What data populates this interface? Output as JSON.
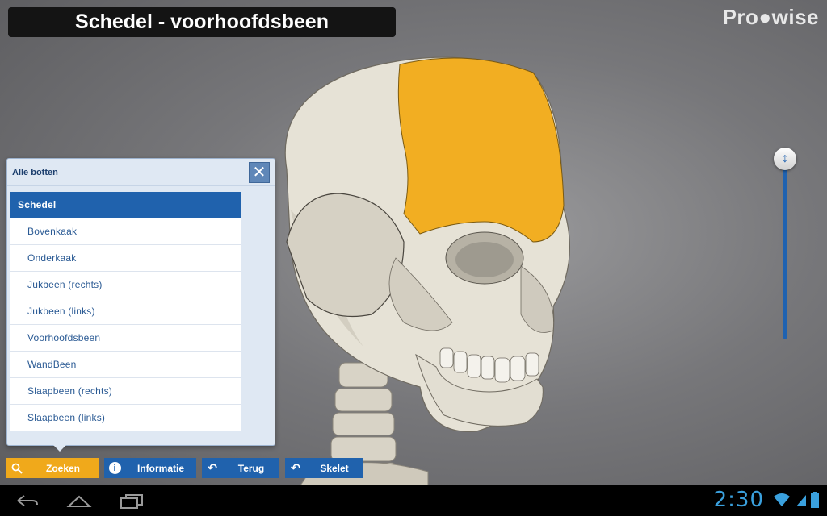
{
  "header": {
    "title": "Schedel - voorhoofdsbeen"
  },
  "brand": {
    "logo_text": "Pro●wise"
  },
  "panel": {
    "title": "Alle botten",
    "close_icon": "close-icon",
    "items": [
      {
        "label": "Schedel",
        "selected": true
      },
      {
        "label": "Bovenkaak"
      },
      {
        "label": "Onderkaak"
      },
      {
        "label": "Jukbeen (rechts)"
      },
      {
        "label": "Jukbeen (links)"
      },
      {
        "label": "Voorhoofdsbeen"
      },
      {
        "label": "WandBeen"
      },
      {
        "label": "Slaapbeen (rechts)"
      },
      {
        "label": "Slaapbeen (links)"
      }
    ]
  },
  "toolbar": {
    "search_label": "Zoeken",
    "info_label": "Informatie",
    "back_label": "Terug",
    "skeleton_label": "Skelet"
  },
  "system": {
    "clock": "2:30"
  },
  "colors": {
    "accent_blue": "#2062ad",
    "highlight_orange": "#f0a91b",
    "bone": "#e6e2d6",
    "frontal_bone": "#f2ae22"
  }
}
